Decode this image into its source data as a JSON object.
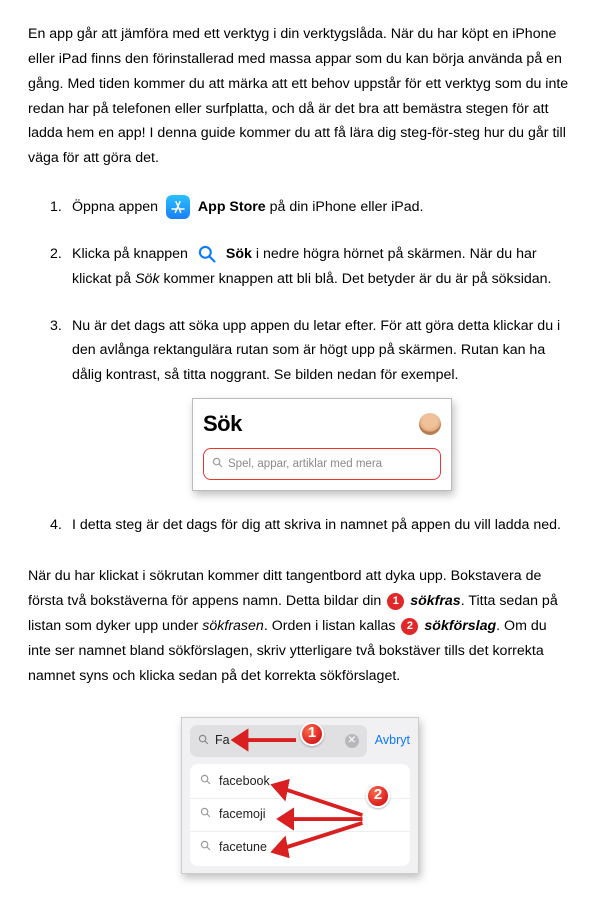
{
  "intro": "En app går att jämföra med ett verktyg i din verktygslåda. När du har köpt en iPhone eller iPad finns den förinstallerad med massa appar som du kan börja använda på en gång. Med tiden kommer du att märka att ett behov uppstår för ett verktyg som du inte redan har på telefonen eller surfplatta, och då är det bra att bemästra stegen för att ladda hem en app! I denna guide kommer du att få lära dig steg-för-steg hur du går till väga för att göra det.",
  "steps": {
    "s1": {
      "num": "1.",
      "a": "Öppna appen",
      "bold": "App Store",
      "b": "på din iPhone eller iPad."
    },
    "s2": {
      "num": "2.",
      "a": "Klicka på knappen",
      "bold": "Sök",
      "b": "i nedre högra hörnet på skärmen. När du har klickat på",
      "italic": "Sök",
      "c": "kommer knappen att bli blå. Det betyder är du är på söksidan."
    },
    "s3": {
      "num": "3.",
      "text": "Nu är det dags att söka upp appen du letar efter. För att göra detta klickar du i den avlånga rektangulära rutan som är högt upp på skärmen. Rutan kan ha dålig kontrast, så titta noggrant. Se bilden nedan för exempel."
    },
    "s4": {
      "num": "4.",
      "text": "I detta steg är det dags för dig att skriva in namnet på appen du vill ladda ned."
    }
  },
  "fig1": {
    "title": "Sök",
    "placeholder": "Spel, appar, artiklar med mera"
  },
  "para2": {
    "a": "När du har klickat i sökrutan kommer ditt tangentbord att dyka upp. Bokstavera de första två bokstäverna för appens namn. Detta bildar din",
    "bold1": "sökfras",
    "b": ". Titta sedan på listan som dyker upp under",
    "italic1": "sökfrasen",
    "c": ". Orden i listan kallas",
    "bold2": "sökförslag",
    "d": ". Om du inte ser namnet bland sökförslagen, skriv ytterligare två bokstäver tills det korrekta namnet syns och klicka sedan på det korrekta sökförslaget."
  },
  "fig2": {
    "query": "Fa",
    "cancel": "Avbryt",
    "rows": [
      "facebook",
      "facemoji",
      "facetune"
    ]
  },
  "badges": {
    "one": "1",
    "two": "2"
  }
}
